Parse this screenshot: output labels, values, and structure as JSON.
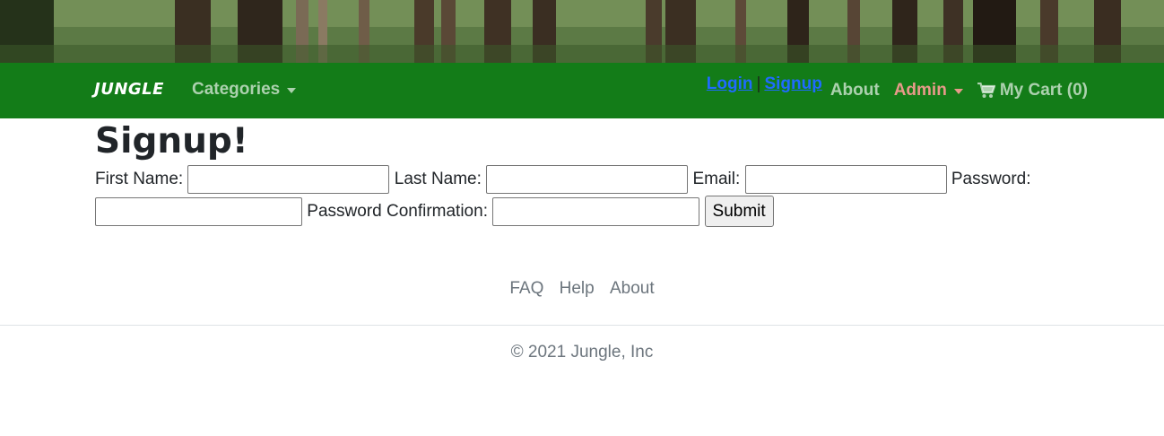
{
  "navbar": {
    "brand": "JUNGLE",
    "categories_label": "Categories",
    "login_label": "Login",
    "separator": "|",
    "signup_label": "Signup",
    "about_label": "About",
    "admin_label": "Admin",
    "cart_label": "My Cart (0)"
  },
  "page": {
    "title": "Signup!"
  },
  "form": {
    "first_name_label": "First Name:",
    "first_name_value": "",
    "last_name_label": "Last Name:",
    "last_name_value": "",
    "email_label": "Email:",
    "email_value": "",
    "password_label": "Password:",
    "password_value": "",
    "password_confirmation_label": "Password Confirmation:",
    "password_confirmation_value": "",
    "submit_label": "Submit"
  },
  "footer": {
    "links": [
      "FAQ",
      "Help",
      "About"
    ],
    "copyright": "© 2021 Jungle, Inc"
  },
  "colors": {
    "navbar_bg": "#137c18",
    "link_blue": "#1f6bff",
    "admin_salmon": "#e89a8a"
  }
}
